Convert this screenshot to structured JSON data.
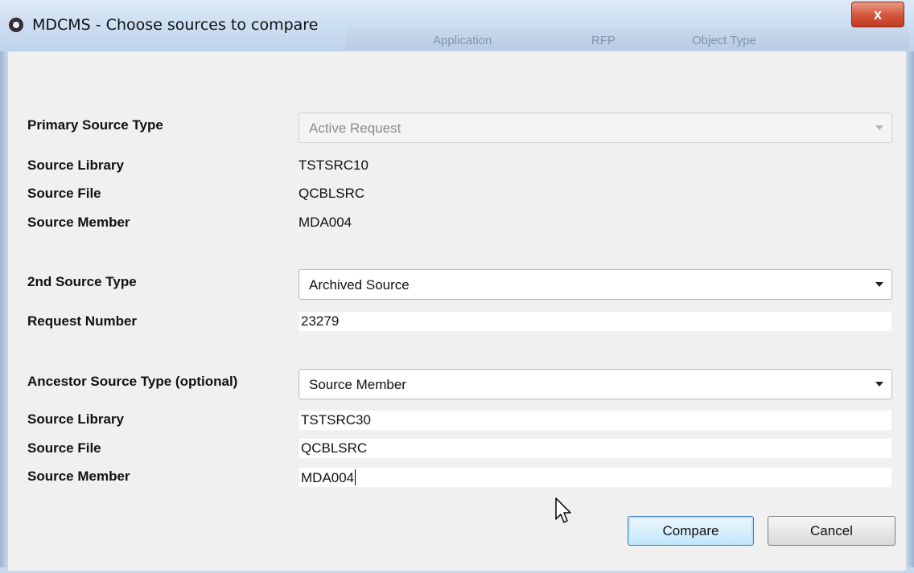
{
  "window": {
    "title": "MDCMS - Choose sources to compare",
    "close_label": "x",
    "background_headers": [
      "Application",
      "RFP",
      "Object Type"
    ]
  },
  "primary": {
    "type_label": "Primary Source Type",
    "type_value": "Active Request",
    "library_label": "Source Library",
    "library_value": "TSTSRC10",
    "file_label": "Source File",
    "file_value": "QCBLSRC",
    "member_label": "Source Member",
    "member_value": "MDA004"
  },
  "second": {
    "type_label": "2nd Source Type",
    "type_value": "Archived Source",
    "request_label": "Request Number",
    "request_value": "23279"
  },
  "ancestor": {
    "type_label": "Ancestor Source Type (optional)",
    "type_value": "Source Member",
    "library_label": "Source Library",
    "library_value": "TSTSRC30",
    "file_label": "Source File",
    "file_value": "QCBLSRC",
    "member_label": "Source Member",
    "member_value": "MDA004"
  },
  "buttons": {
    "compare": "Compare",
    "cancel": "Cancel"
  },
  "icons": {
    "app": "app-icon",
    "close": "close-icon",
    "dropdown": "chevron-down-icon",
    "cursor": "mouse-pointer-icon"
  }
}
